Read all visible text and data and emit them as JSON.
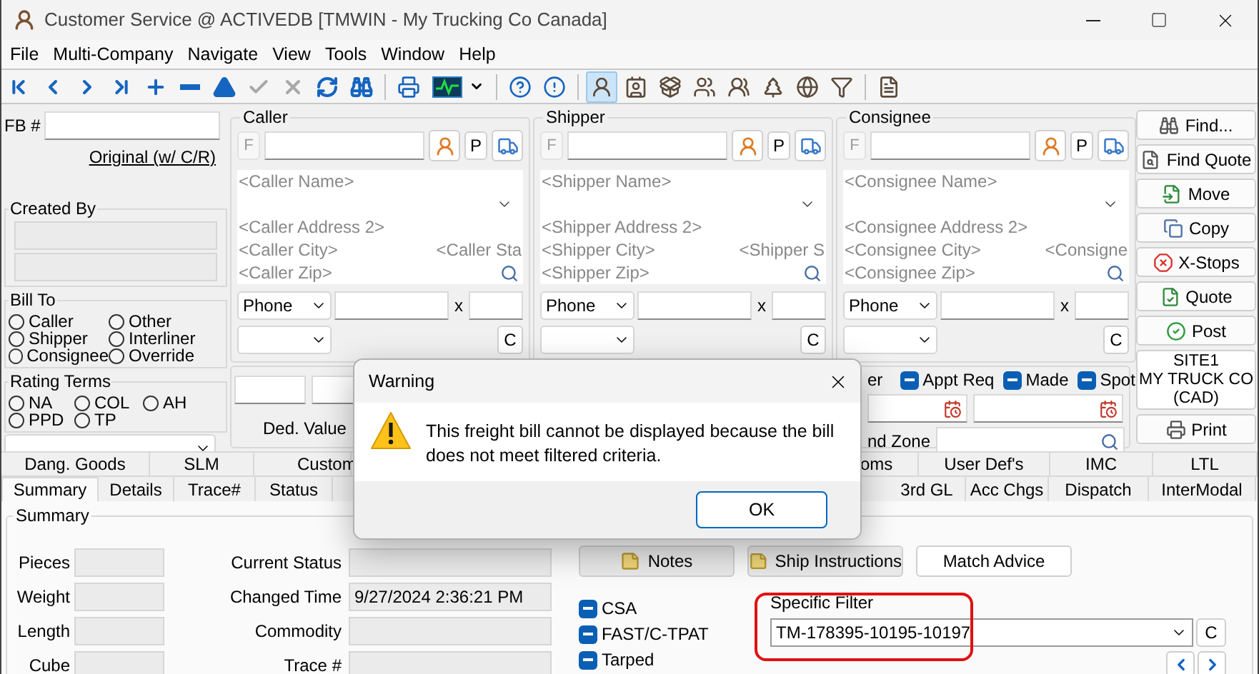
{
  "window": {
    "title": "Customer Service @ ACTIVEDB [TMWIN - My Trucking Co Canada]"
  },
  "menu": [
    "File",
    "Multi-Company",
    "Navigate",
    "View",
    "Tools",
    "Window",
    "Help"
  ],
  "toolbar": [
    {
      "disabled": false
    },
    {
      "disabled": false
    },
    {
      "disabled": false
    },
    {
      "disabled": false
    },
    {
      "disabled": false
    },
    {
      "disabled": false
    },
    {
      "disabled": false
    },
    {
      "disabled": true
    },
    {
      "disabled": true
    },
    {
      "disabled": false
    },
    {
      "disabled": false
    },
    {
      "disabled": false
    },
    {
      "disabled": false
    },
    {
      "disabled": false
    },
    {
      "disabled": false
    },
    {
      "selected": true,
      "disabled": false
    },
    {
      "selected": false,
      "disabled": false
    },
    {
      "selected": false,
      "disabled": false
    },
    {
      "selected": false,
      "disabled": false
    },
    {
      "selected": false,
      "disabled": false
    },
    {
      "selected": false,
      "disabled": false
    },
    {
      "selected": false,
      "disabled": false
    },
    {
      "selected": false,
      "disabled": false
    },
    {
      "selected": false,
      "disabled": false
    }
  ],
  "fb": {
    "label": "FB #",
    "link": "Original (w/ C/R)"
  },
  "created_by": {
    "title": "Created By"
  },
  "bill_to": {
    "title": "Bill To",
    "options": [
      {
        "label": "Caller",
        "selected": false
      },
      {
        "label": "Other",
        "selected": false
      },
      {
        "label": "Shipper",
        "selected": false
      },
      {
        "label": "Interliner",
        "selected": false
      },
      {
        "label": "Consignee",
        "selected": false
      },
      {
        "label": "Override",
        "selected": false
      }
    ]
  },
  "rating_terms": {
    "title": "Rating Terms",
    "options": [
      {
        "label": "NA",
        "selected": false
      },
      {
        "label": "COL",
        "selected": false
      },
      {
        "label": "AH",
        "selected": false
      },
      {
        "label": "PPD",
        "selected": false
      },
      {
        "label": "TP",
        "selected": false
      }
    ]
  },
  "parties": [
    {
      "title": "Caller",
      "f_label": "F",
      "p_label": "P",
      "c_label": "C",
      "x_label": "x",
      "name": "<Caller Name>",
      "address_2": "<Caller Address 2>",
      "city": "<Caller City>",
      "state": "<Caller Sta",
      "zip": "<Caller Zip>",
      "phone_type": "Phone"
    },
    {
      "title": "Shipper",
      "f_label": "F",
      "p_label": "P",
      "c_label": "C",
      "x_label": "x",
      "name": "<Shipper Name>",
      "address_2": "<Shipper Address 2>",
      "city": "<Shipper City>",
      "state": "<Shipper S",
      "zip": "<Shipper Zip>",
      "phone_type": "Phone"
    },
    {
      "title": "Consignee",
      "f_label": "F",
      "p_label": "P",
      "c_label": "C",
      "x_label": "x",
      "name": "<Consignee Name>",
      "address_2": "<Consignee Address 2>",
      "city": "<Consignee City>",
      "state": "<Consigne",
      "zip": "<Consignee Zip>",
      "phone_type": "Phone"
    }
  ],
  "middle": {
    "ded_value_label": "Ded. Value",
    "partial_label": "er",
    "appt_flags": [
      {
        "label": "Appt Req",
        "indeterminate": true
      },
      {
        "label": "Made",
        "indeterminate": true
      },
      {
        "label": "Spot",
        "indeterminate": true
      }
    ],
    "zone_label": "nd Zone"
  },
  "actions": [
    {
      "label": "Find...",
      "kind": "action"
    },
    {
      "label": "Find Quote",
      "kind": "action"
    },
    {
      "label": "Move",
      "kind": "action"
    },
    {
      "label": "Copy",
      "kind": "action"
    },
    {
      "label": "X-Stops",
      "kind": "action"
    },
    {
      "label": "Quote",
      "kind": "action"
    },
    {
      "label": "Post",
      "kind": "action"
    },
    {
      "label": "SITE1\nMY TRUCK CO\n(CAD)",
      "kind": "site"
    },
    {
      "label": "Print",
      "kind": "action"
    }
  ],
  "tabs_top": [
    {
      "label": "Dang. Goods",
      "selected": false
    },
    {
      "label": "SLM",
      "selected": false
    },
    {
      "label": "Custom",
      "selected": false
    },
    {
      "label": "oms",
      "selected": false
    },
    {
      "label": "User Def's",
      "selected": false
    },
    {
      "label": "IMC",
      "selected": false
    },
    {
      "label": "LTL",
      "selected": false
    }
  ],
  "tabs_bottom": [
    {
      "label": "Summary",
      "selected": true
    },
    {
      "label": "Details",
      "selected": false
    },
    {
      "label": "Trace#",
      "selected": false
    },
    {
      "label": "Status",
      "selected": false
    },
    {
      "label": "3rd GL",
      "selected": false
    },
    {
      "label": "Acc Chgs",
      "selected": false
    },
    {
      "label": "Dispatch",
      "selected": false
    },
    {
      "label": "InterModal",
      "selected": false
    }
  ],
  "summary": {
    "title": "Summary",
    "left_fields": [
      {
        "label": "Pieces"
      },
      {
        "label": "Weight"
      },
      {
        "label": "Length"
      },
      {
        "label": "Cube"
      }
    ],
    "mid_fields": [
      {
        "label": "Current Status"
      },
      {
        "label": "Changed Time",
        "value": "9/27/2024 2:36:21 PM"
      },
      {
        "label": "Commodity"
      },
      {
        "label": "Trace #"
      }
    ],
    "buttons": [
      {
        "label": "Notes",
        "kind": "note"
      },
      {
        "label": "Ship Instructions",
        "kind": "note"
      },
      {
        "label": "Match Advice",
        "kind": "plain"
      }
    ],
    "flags": [
      {
        "label": "CSA",
        "indeterminate": true
      },
      {
        "label": "FAST/C-TPAT",
        "indeterminate": true
      },
      {
        "label": "Tarped",
        "indeterminate": true
      }
    ],
    "specific_filter": {
      "label": "Specific Filter",
      "value": "TM-178395-10195-10197",
      "clear_label": "C",
      "highlighted": true
    }
  },
  "dialog": {
    "title": "Warning",
    "message": "This freight bill cannot be displayed because the bill does not meet filtered criteria.",
    "button": "OK"
  }
}
